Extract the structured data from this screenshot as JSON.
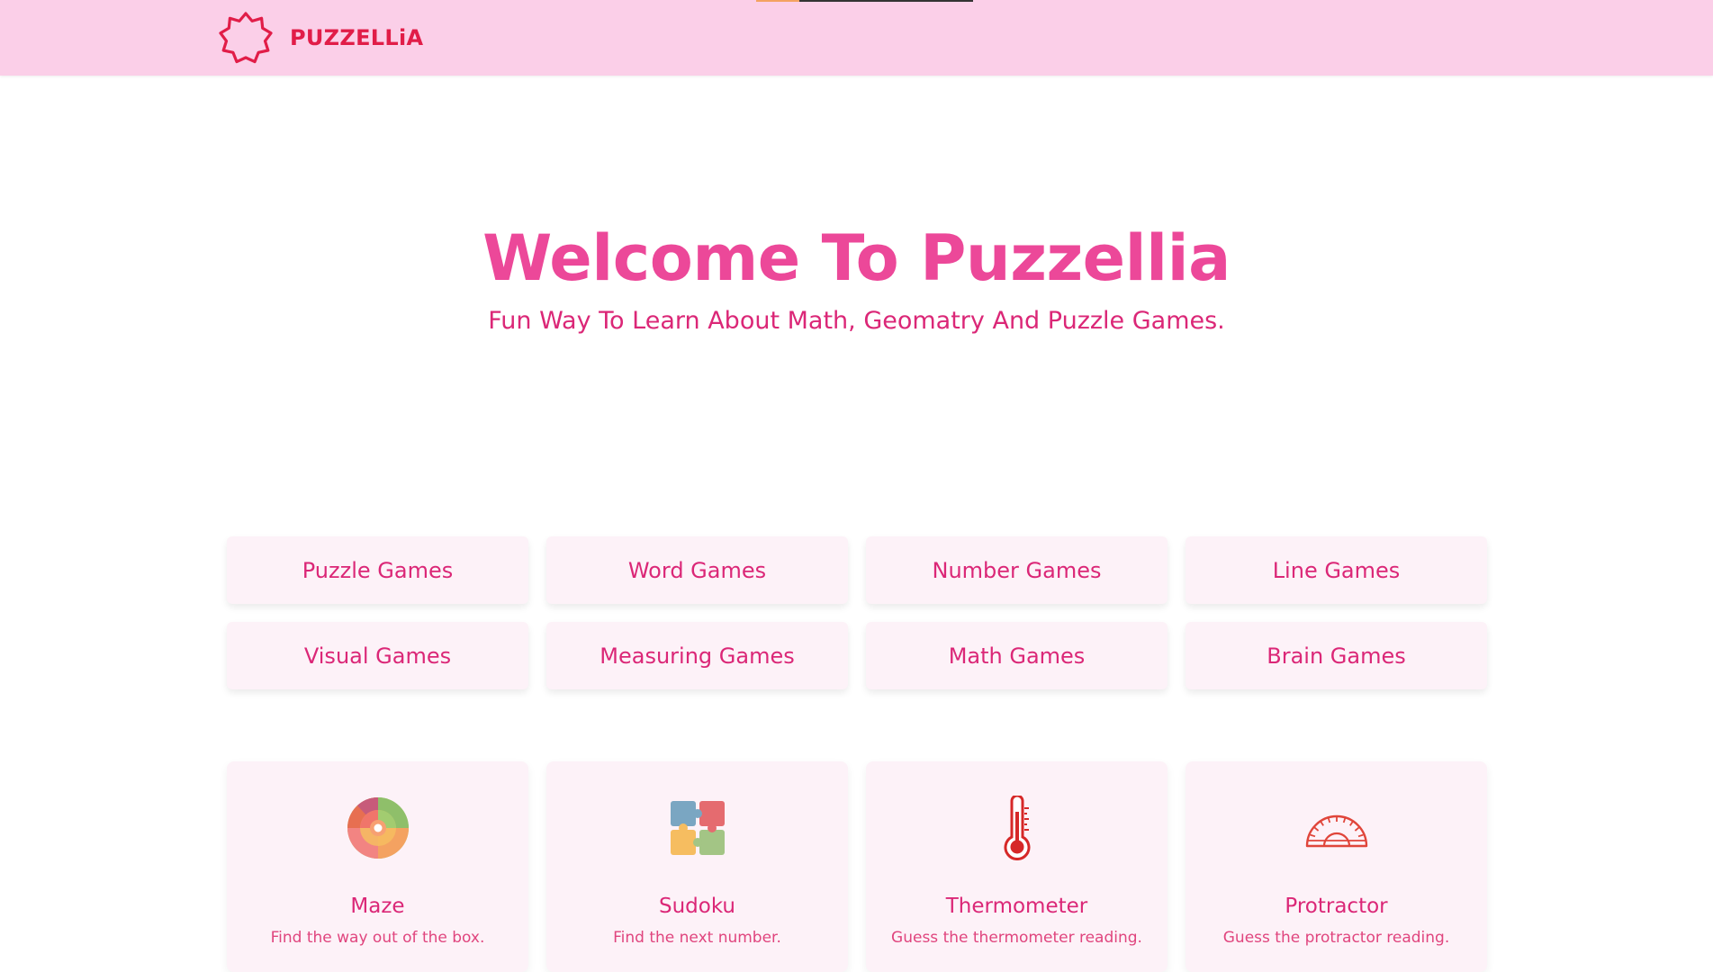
{
  "header": {
    "brand_name": "PUZZELLiA",
    "logo_icon": "star-burst-icon",
    "accent_color": "#e11d48",
    "background_color": "#fbcfe8"
  },
  "hero": {
    "title": "Welcome To Puzzellia",
    "subtitle": "Fun Way To Learn About Math, Geomatry And Puzzle Games."
  },
  "categories": [
    {
      "label": "Puzzle Games"
    },
    {
      "label": "Word Games"
    },
    {
      "label": "Number Games"
    },
    {
      "label": "Line Games"
    },
    {
      "label": "Visual Games"
    },
    {
      "label": "Measuring Games"
    },
    {
      "label": "Math Games"
    },
    {
      "label": "Brain Games"
    }
  ],
  "games": [
    {
      "title": "Maze",
      "description": "Find the way out of the box.",
      "icon": "maze-icon"
    },
    {
      "title": "Sudoku",
      "description": "Find the next number.",
      "icon": "puzzle-pieces-icon"
    },
    {
      "title": "Thermometer",
      "description": "Guess the thermometer reading.",
      "icon": "thermometer-icon"
    },
    {
      "title": "Protractor",
      "description": "Guess the protractor reading.",
      "icon": "protractor-icon"
    }
  ]
}
